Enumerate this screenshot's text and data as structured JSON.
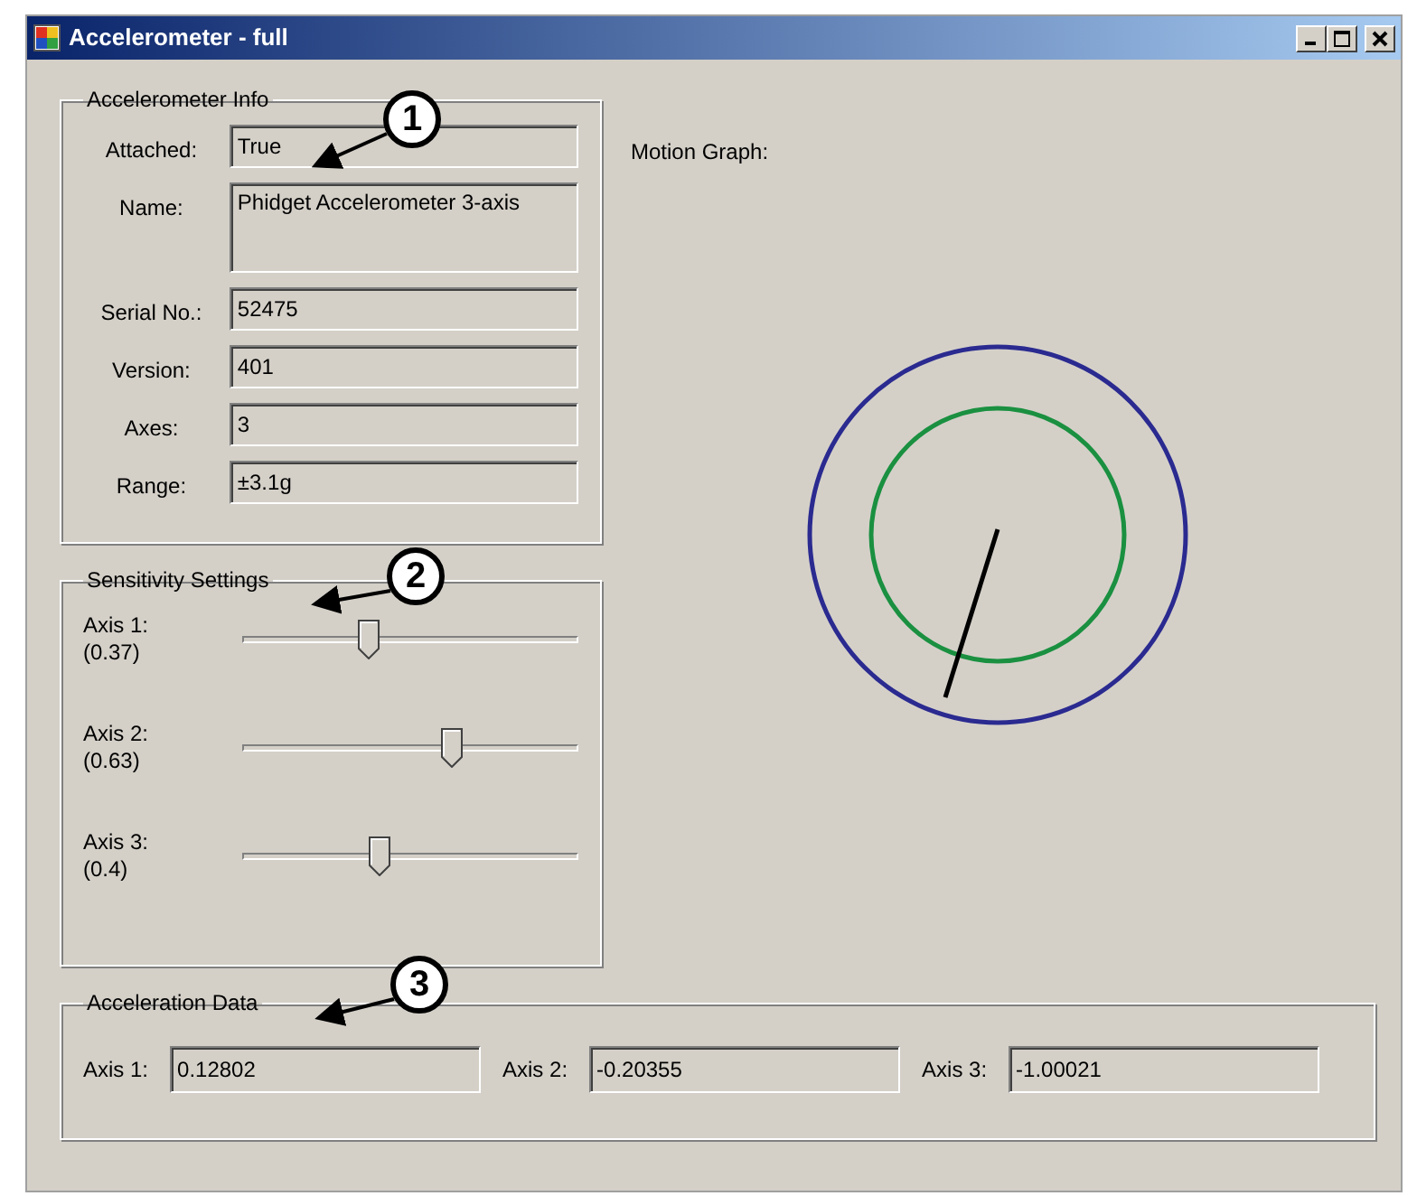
{
  "window": {
    "title": "Accelerometer - full"
  },
  "info": {
    "title": "Accelerometer Info",
    "fields": [
      {
        "label": "Attached:",
        "value": "True",
        "kind": "line"
      },
      {
        "label": "Name:",
        "value": "Phidget Accelerometer 3-axis",
        "kind": "multi"
      },
      {
        "label": "Serial No.:",
        "value": "52475",
        "kind": "line"
      },
      {
        "label": "Version:",
        "value": "401",
        "kind": "line"
      },
      {
        "label": "Axes:",
        "value": "3",
        "kind": "line"
      },
      {
        "label": "Range:",
        "value": "±3.1g",
        "kind": "line"
      }
    ]
  },
  "sensitivity": {
    "title": "Sensitivity Settings",
    "sliders": [
      {
        "label": "Axis 1:",
        "reading": "(0.37)",
        "level": 0.37
      },
      {
        "label": "Axis 2:",
        "reading": "(0.63)",
        "level": 0.63
      },
      {
        "label": "Axis 3:",
        "reading": "(0.4)",
        "level": 0.4
      }
    ]
  },
  "motion_graph": {
    "label": "Motion Graph:"
  },
  "acceleration": {
    "title": "Acceleration Data",
    "axes": [
      {
        "label": "Axis 1:",
        "value": "0.12802"
      },
      {
        "label": "Axis 2:",
        "value": "-0.20355"
      },
      {
        "label": "Axis 3:",
        "value": "-1.00021"
      }
    ]
  },
  "callouts": [
    {
      "number": "1"
    },
    {
      "number": "2"
    },
    {
      "number": "3"
    }
  ]
}
